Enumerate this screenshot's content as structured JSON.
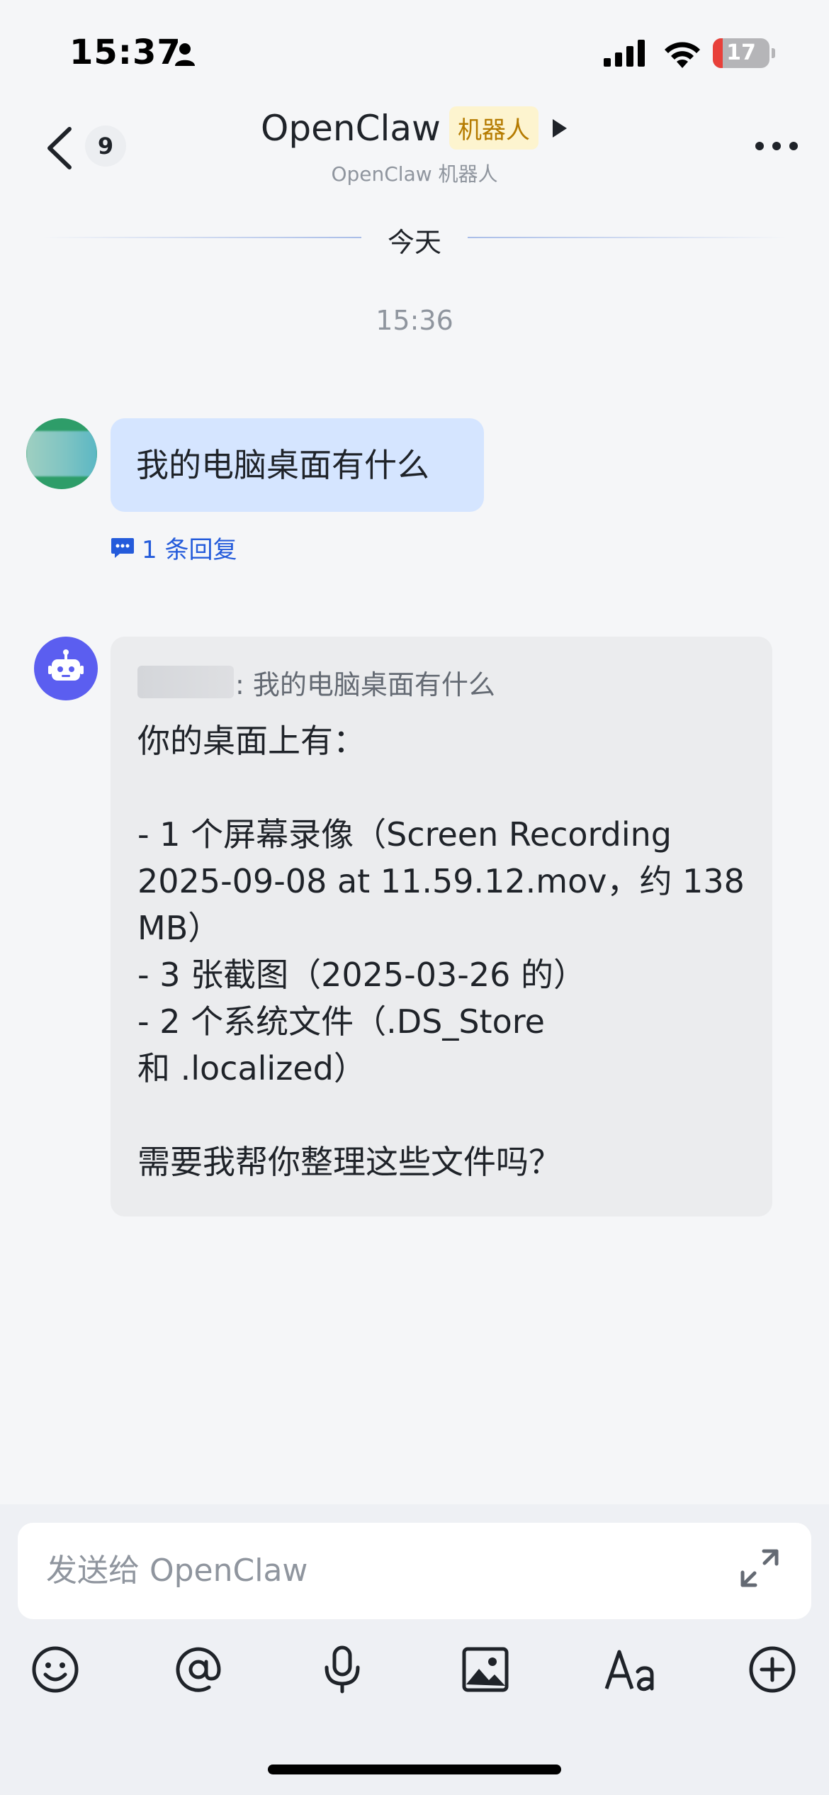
{
  "status_bar": {
    "time": "15:37",
    "battery_level": "17",
    "battery_fraction": 0.17,
    "icons": [
      "person-icon",
      "signal-icon",
      "wifi-icon",
      "battery-icon"
    ]
  },
  "header": {
    "unread_count": "9",
    "title": "OpenClaw",
    "bot_tag": "机器人",
    "subtitle": "OpenClaw 机器人",
    "icons": [
      "back-arrow-icon",
      "play-triangle-icon",
      "more-icon"
    ]
  },
  "conversation": {
    "date_divider": "今天",
    "timestamp": "15:36",
    "user_message": {
      "text": "我的电脑桌面有什么",
      "reply_count_label": "1 条回复"
    },
    "bot_message": {
      "quote_text": ": 我的电脑桌面有什么",
      "lines": [
        "你的桌面上有：",
        "",
        "- 1 个屏幕录像（Screen Recording",
        "2025-09-08 at 11.59.12.mov，约 138",
        "MB）",
        "- 3 张截图（2025-03-26 的）",
        "- 2 个系统文件（.DS_Store",
        "和 .localized）",
        "",
        "需要我帮你整理这些文件吗？"
      ]
    }
  },
  "composer": {
    "placeholder": "发送给 OpenClaw",
    "toolbar_icons": [
      "emoji-icon",
      "mention-icon",
      "microphone-icon",
      "image-icon",
      "text-format-icon",
      "plus-icon"
    ],
    "accent_color": "#245bdb"
  }
}
